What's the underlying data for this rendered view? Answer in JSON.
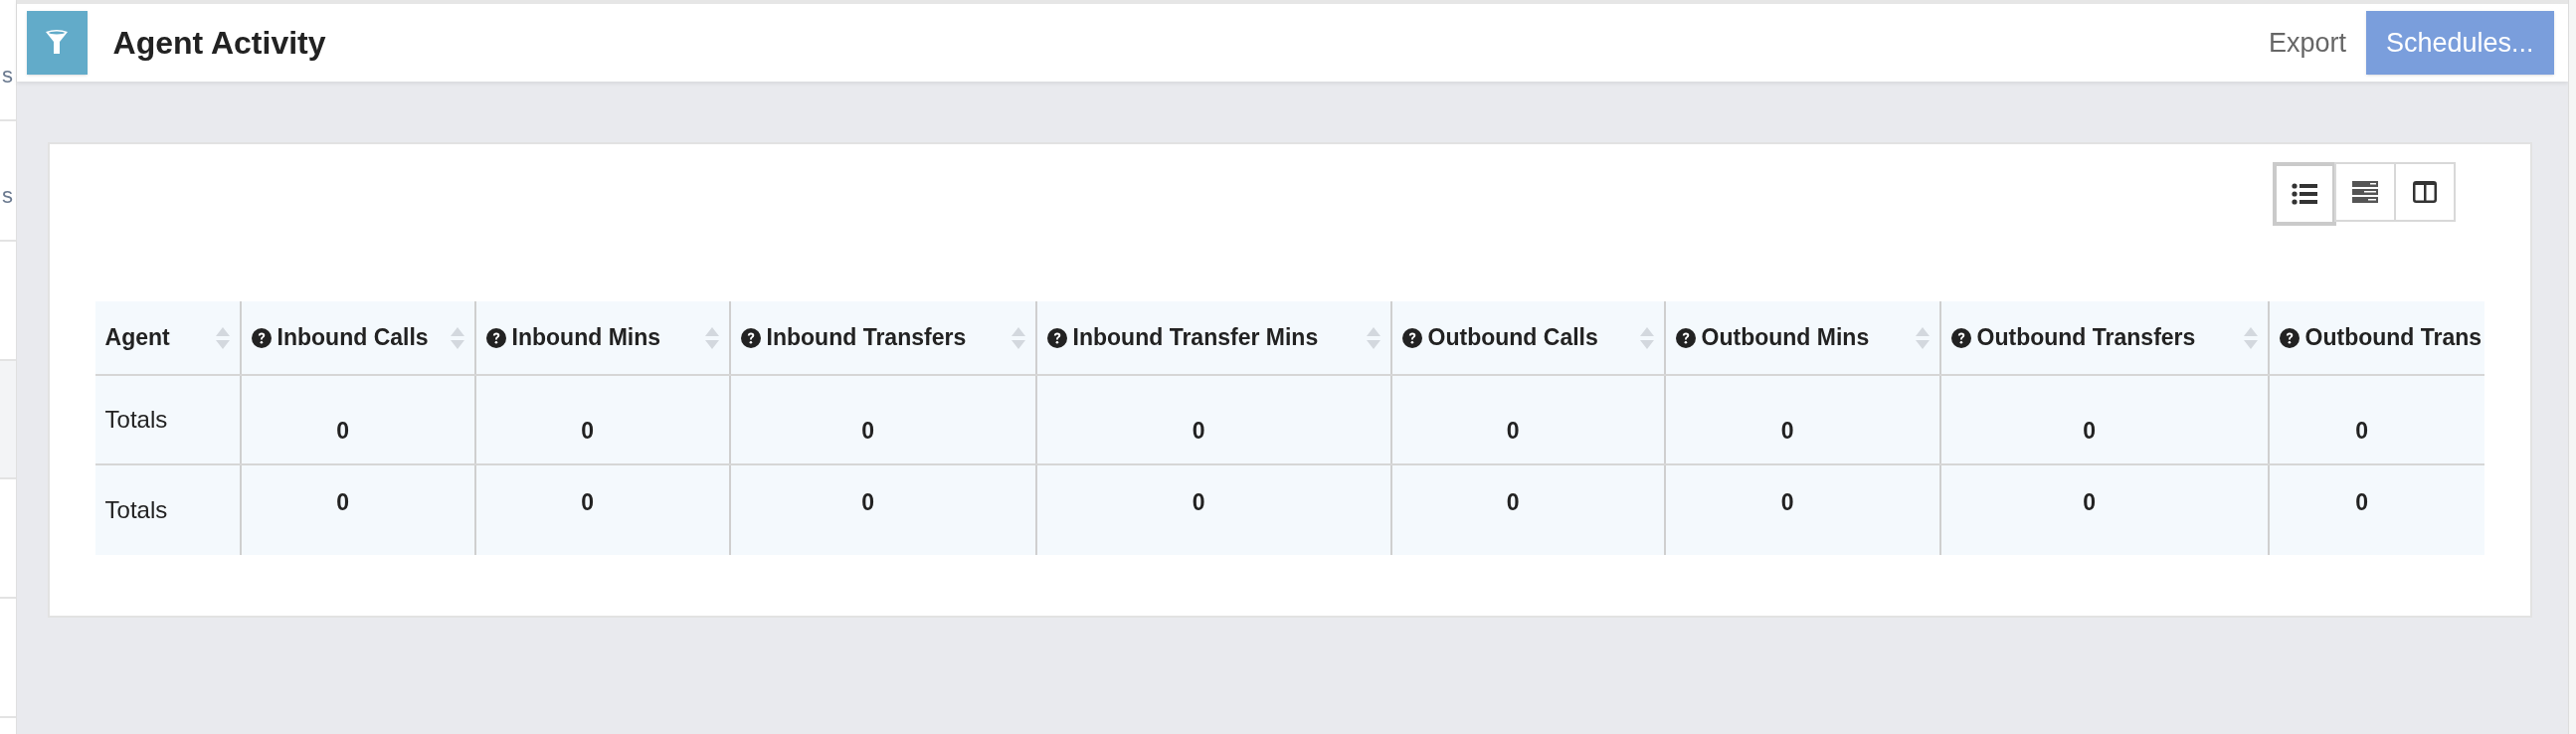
{
  "sidebar": {
    "items": [
      {
        "text": "s",
        "selected": false
      },
      {
        "text": "s",
        "selected": false
      },
      {
        "selected": false
      },
      {
        "selected": true
      },
      {
        "selected": false
      },
      {
        "selected": false
      }
    ]
  },
  "header": {
    "title": "Agent Activity",
    "export": "Export",
    "schedules": "Schedules..."
  },
  "view_toggles": [
    {
      "kind": "list",
      "selected": true
    },
    {
      "kind": "rows",
      "selected": false
    },
    {
      "kind": "columns",
      "selected": false
    }
  ],
  "table": {
    "columns": [
      {
        "label": "Agent",
        "help": false,
        "sortable": true
      },
      {
        "label": "Inbound Calls",
        "help": true,
        "sortable": true
      },
      {
        "label": "Inbound Mins",
        "help": true,
        "sortable": true
      },
      {
        "label": "Inbound Transfers",
        "help": true,
        "sortable": true
      },
      {
        "label": "Inbound Transfer Mins",
        "help": true,
        "sortable": true
      },
      {
        "label": "Outbound Calls",
        "help": true,
        "sortable": true
      },
      {
        "label": "Outbound Mins",
        "help": true,
        "sortable": true
      },
      {
        "label": "Outbound Transfers",
        "help": true,
        "sortable": true
      },
      {
        "label": "Outbound Trans",
        "help": true,
        "sortable": false
      }
    ],
    "rows": [
      {
        "cells": [
          "Totals",
          "0",
          "0",
          "0",
          "0",
          "0",
          "0",
          "0",
          "0"
        ]
      },
      {
        "cells": [
          "Totals",
          "0",
          "0",
          "0",
          "0",
          "0",
          "0",
          "0",
          "0"
        ]
      }
    ]
  }
}
